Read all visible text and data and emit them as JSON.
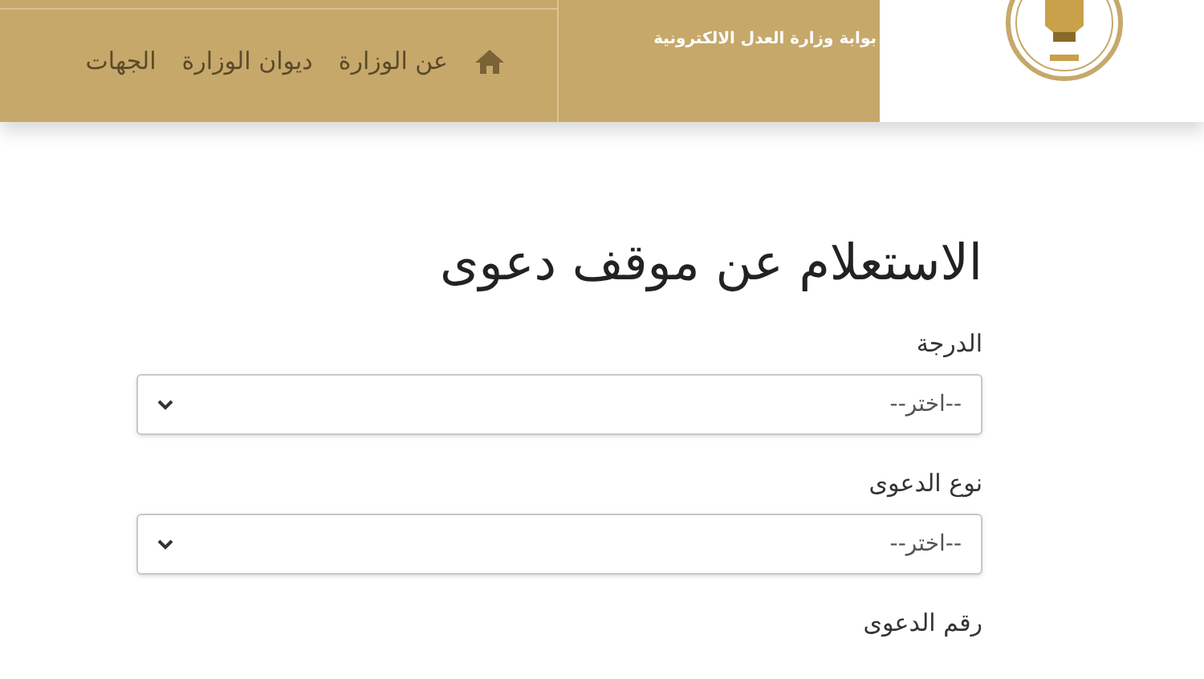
{
  "header": {
    "portal_name": "بوابة وزارة العدل الالكترونية",
    "nav": [
      {
        "label": "عن الوزارة",
        "kind": "link"
      },
      {
        "label": "ديوان الوزارة",
        "kind": "link"
      },
      {
        "label": "الجهات",
        "kind": "link"
      }
    ]
  },
  "title": "الاستعلام عن موقف دعوى",
  "fields": [
    {
      "label": "الدرجة",
      "kind": "select",
      "value": "--اختر--"
    },
    {
      "label": "نوع الدعوى",
      "kind": "select",
      "value": "--اختر--"
    },
    {
      "label": "رقم الدعوى",
      "kind": "label"
    }
  ]
}
